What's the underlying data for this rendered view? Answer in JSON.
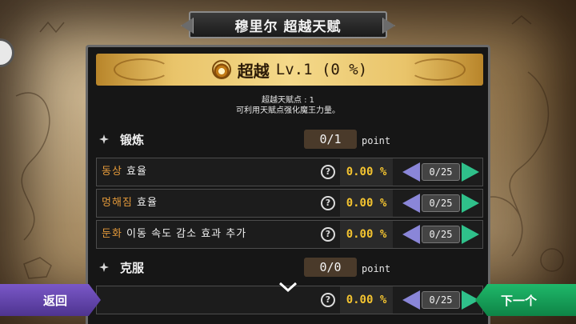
{
  "window_title": "穆里尔  超越天赋",
  "banner": {
    "title": "超越",
    "level_text": "Lv.1 (0 %)",
    "icon": "flame-emblem-icon"
  },
  "description": {
    "line1": "超越天赋点 : 1",
    "line2": "可利用天赋点强化魔王力量。"
  },
  "sections": [
    {
      "name": "锻炼",
      "points": "0/1",
      "unit": "point",
      "rows": [
        {
          "highlight": "동상",
          "rest": " 효율",
          "value": "0.00 %",
          "level": "0/25"
        },
        {
          "highlight": "멍해짐",
          "rest": " 효율",
          "value": "0.00 %",
          "level": "0/25"
        },
        {
          "highlight": "둔화",
          "rest": " 이동 속도 감소 효과 추가",
          "value": "0.00 %",
          "level": "0/25"
        }
      ]
    },
    {
      "name": "克服",
      "points": "0/0",
      "unit": "point",
      "rows": [
        {
          "highlight": "",
          "rest": "",
          "value": "0.00 %",
          "level": "0/25"
        }
      ]
    }
  ],
  "help_glyph": "?",
  "footer": {
    "back_label": "返回",
    "next_label": "下一个"
  },
  "colors": {
    "banner_gold": "#e9c46a",
    "value_yellow": "#f4c430",
    "highlight_orange": "#e49a3a",
    "decrement_purple": "#8a86d8",
    "increment_green": "#2fc08a",
    "back_purple": "#6a4ab8",
    "next_green": "#1fb86a"
  }
}
